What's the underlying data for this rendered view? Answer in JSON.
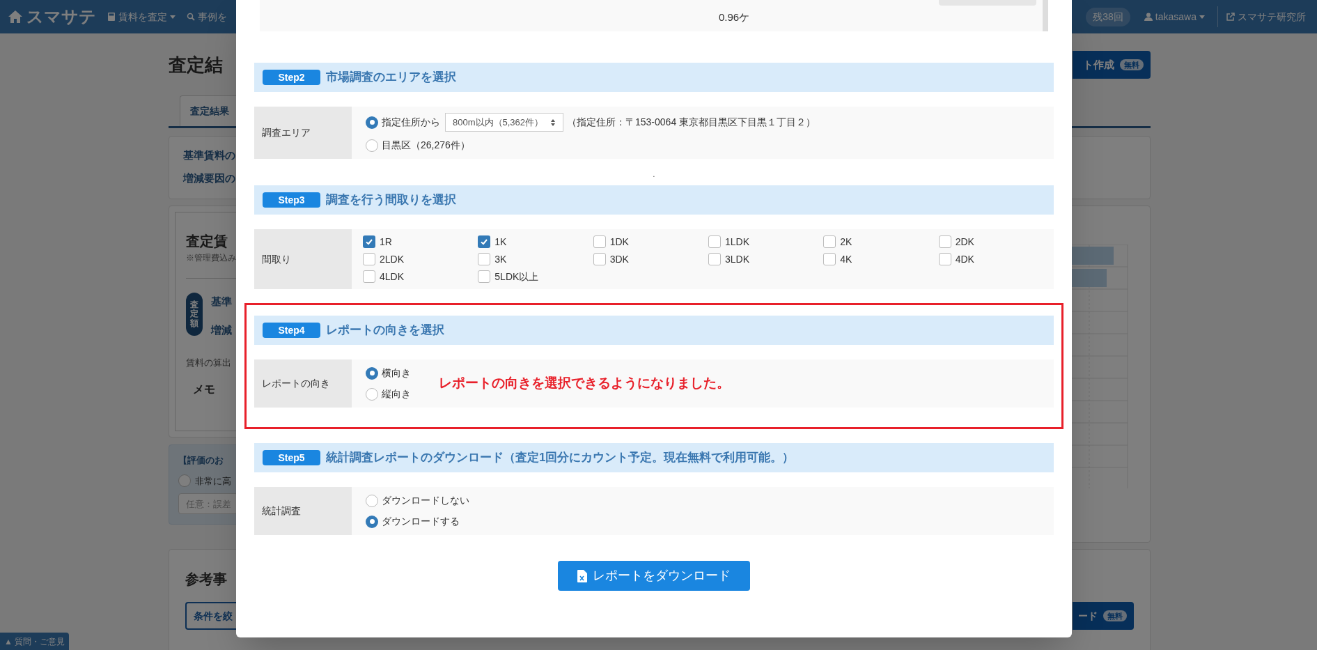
{
  "header": {
    "logo": "スマサテ",
    "nav": [
      "賃料を査定",
      "事例を"
    ],
    "remaining": "残38回",
    "user": "takasawa",
    "lab": "スマサテ研究所"
  },
  "background": {
    "title": "査定結",
    "report_button": "ト作成",
    "report_badge": "無料",
    "tab": "査定結果",
    "summary": [
      "基準賃料の",
      "増減要因の"
    ],
    "rent_title": "査定賃",
    "rent_note": "※管理費込み",
    "rent_badge": "査定額",
    "rent_items": [
      "基準",
      "増減"
    ],
    "method": "賃料の算出",
    "memo": "メモ",
    "rating_title": "【評価のお",
    "rating_option": {
      "label": "非常に高",
      "selected": false
    },
    "rating_placeholder": "任意：誤差",
    "cases_title": "参考事",
    "filter_button": "条件を絞",
    "download_button": "ード",
    "download_badge": "無料",
    "feedback": "▲ 質問・ご意見"
  },
  "modal": {
    "top_row": {
      "cells": [
        "0.96ケ"
      ]
    },
    "steps": [
      {
        "kind": "area",
        "badge": "Step2",
        "title": "市場調査のエリアを選択",
        "label": "調査エリア",
        "highlighted": false,
        "options": [
          {
            "label": "指定住所から",
            "selected": true,
            "select": "800m以内（5,362件）",
            "note": "（指定住所：〒153-0064 東京都目黒区下目黒１丁目２）"
          },
          {
            "label": "目黒区（26,276件）",
            "selected": false
          }
        ]
      },
      {
        "kind": "checks",
        "badge": "Step3",
        "title": "調査を行う間取りを選択",
        "label": "間取り",
        "highlighted": false,
        "separator": ".",
        "options": [
          {
            "label": "1R",
            "checked": true
          },
          {
            "label": "1K",
            "checked": true
          },
          {
            "label": "1DK",
            "checked": false
          },
          {
            "label": "1LDK",
            "checked": false
          },
          {
            "label": "2K",
            "checked": false
          },
          {
            "label": "2DK",
            "checked": false
          },
          {
            "label": "2LDK",
            "checked": false
          },
          {
            "label": "3K",
            "checked": false
          },
          {
            "label": "3DK",
            "checked": false
          },
          {
            "label": "3LDK",
            "checked": false
          },
          {
            "label": "4K",
            "checked": false
          },
          {
            "label": "4DK",
            "checked": false
          },
          {
            "label": "4LDK",
            "checked": false
          },
          {
            "label": "5LDK以上",
            "checked": false
          }
        ]
      },
      {
        "kind": "radios",
        "badge": "Step4",
        "title": "レポートの向きを選択",
        "label": "レポートの向き",
        "highlighted": true,
        "note": "レポートの向きを選択できるようになりました。",
        "options": [
          {
            "label": "横向き",
            "selected": true
          },
          {
            "label": "縦向き",
            "selected": false
          }
        ]
      },
      {
        "kind": "radios",
        "badge": "Step5",
        "title": "統計調査レポートのダウンロード（査定1回分にカウント予定。現在無料で利用可能。）",
        "label": "統計調査",
        "highlighted": false,
        "options": [
          {
            "label": "ダウンロードしない",
            "selected": false
          },
          {
            "label": "ダウンロードする",
            "selected": true
          }
        ]
      }
    ],
    "download_button": "レポートをダウンロード"
  }
}
